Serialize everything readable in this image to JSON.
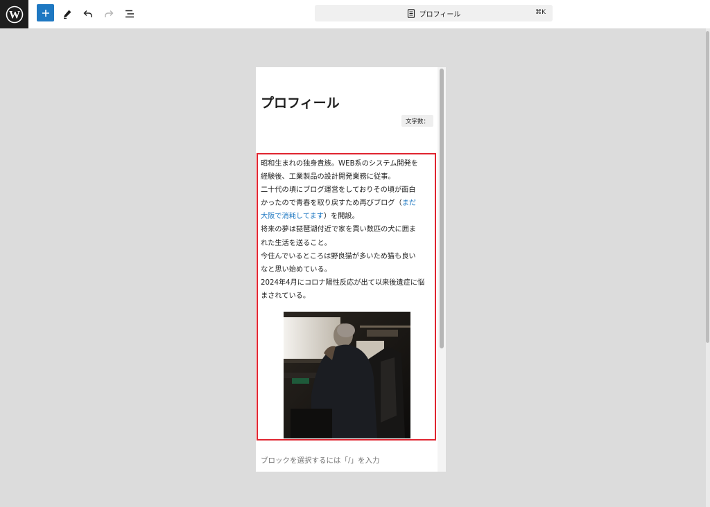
{
  "toolbar": {
    "logo_icon": "wordpress-logo-icon",
    "add_icon": "plus-icon",
    "edit_icon": "pencil-icon",
    "undo_icon": "undo-icon",
    "redo_icon": "redo-icon",
    "outline_icon": "list-view-icon",
    "accent_color": "#1e78c2"
  },
  "command_bar": {
    "icon": "page-icon",
    "title": "プロフィール",
    "shortcut": "⌘K"
  },
  "editor": {
    "post_title": "プロフィール",
    "char_count_label": "文字数：",
    "paragraph": {
      "line1": "昭和生まれの独身貴族。WEB系のシステム開発を",
      "line2": "経験後、工業製品の設計開発業務に従事。",
      "line3": "二十代の頃にブログ運営をしておりその頃が面白",
      "line4_before": "かったので青春を取り戻すため再びブログ（",
      "link_part1": "まだ",
      "link_part2": "大阪で消耗してます",
      "line5_after": "）を開設。",
      "line6": "将来の夢は琵琶湖付近で家を買い数匹の犬に囲ま",
      "line7": "れた生活を送ること。",
      "line8": "今住んでいるところは野良猫が多いため猫も良い",
      "line9": "なと思い始めている。",
      "line10": "2024年4月にコロナ陽性反応が出て以来後遺症に悩",
      "line11": "まされている。"
    },
    "selected_block_border_color": "#e0242f",
    "image_subject": "photo of a person sitting at a desk with a monitor",
    "appender_placeholder": "ブロックを選択するには「/」を入力"
  }
}
